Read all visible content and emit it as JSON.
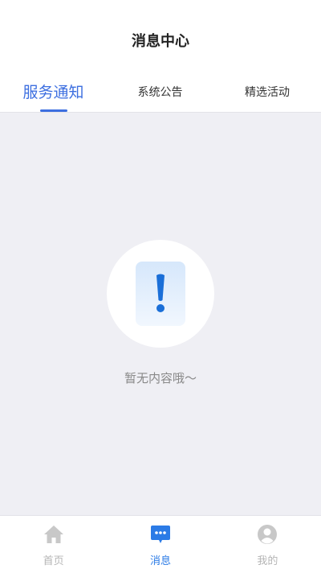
{
  "header": {
    "title": "消息中心"
  },
  "tabs": [
    {
      "label": "服务通知",
      "active": true
    },
    {
      "label": "系统公告",
      "active": false
    },
    {
      "label": "精选活动",
      "active": false
    }
  ],
  "empty_state": {
    "icon": "exclamation-document-icon",
    "text": "暂无内容哦～"
  },
  "tabbar": [
    {
      "label": "首页",
      "icon": "home-icon",
      "active": false
    },
    {
      "label": "消息",
      "icon": "message-icon",
      "active": true
    },
    {
      "label": "我的",
      "icon": "profile-icon",
      "active": false
    }
  ],
  "colors": {
    "accent": "#3d6fe0",
    "tabbar_active": "#2b7be6",
    "inactive": "#b5b5b5",
    "background": "#efeff4"
  }
}
